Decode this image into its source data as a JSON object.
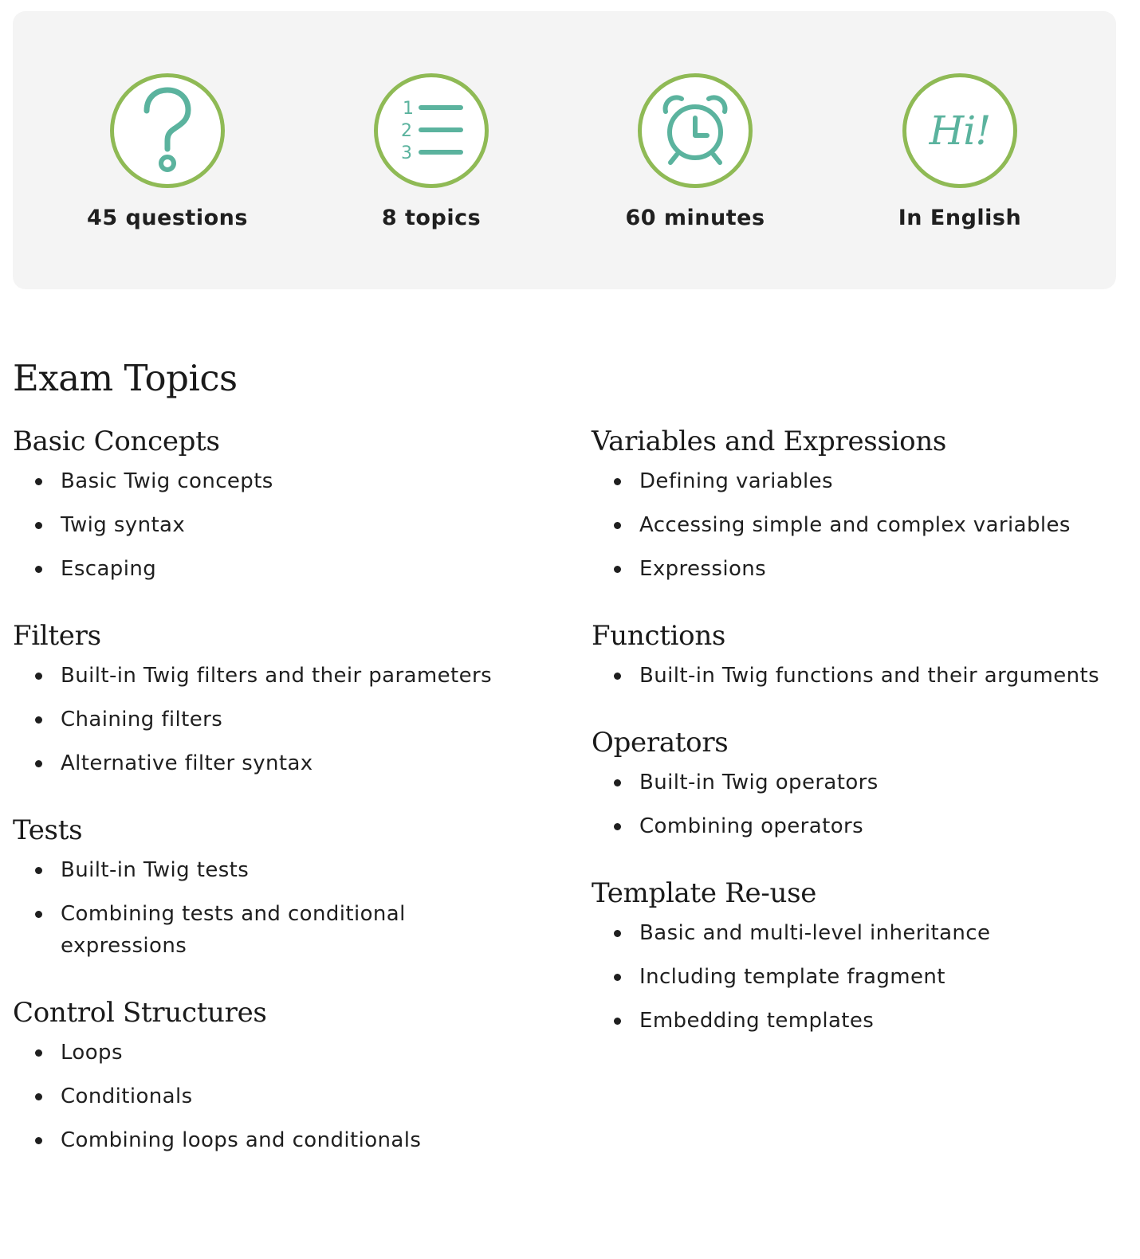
{
  "stats": [
    {
      "name": "questions",
      "icon": "question-mark-icon",
      "label": "45 questions"
    },
    {
      "name": "topics",
      "icon": "numbered-list-icon",
      "label": "8 topics",
      "list_numbers": [
        "1",
        "2",
        "3"
      ]
    },
    {
      "name": "minutes",
      "icon": "alarm-clock-icon",
      "label": "60 minutes"
    },
    {
      "name": "language",
      "icon": "hi-greeting-icon",
      "label": "In English",
      "icon_text": "Hi!"
    }
  ],
  "colors": {
    "accent_ring": "#8fba55",
    "icon_teal": "#5bb39e",
    "panel_bg": "#f4f4f4",
    "text": "#1a1a1a"
  },
  "page_title": "Exam Topics",
  "topics_left": [
    {
      "title": "Basic Concepts",
      "items": [
        "Basic Twig concepts",
        "Twig syntax",
        "Escaping"
      ]
    },
    {
      "title": "Filters",
      "items": [
        "Built-in Twig filters and their parameters",
        "Chaining filters",
        "Alternative filter syntax"
      ]
    },
    {
      "title": "Tests",
      "items": [
        "Built-in Twig tests",
        "Combining tests and conditional expressions"
      ]
    },
    {
      "title": "Control Structures",
      "items": [
        "Loops",
        "Conditionals",
        "Combining loops and conditionals"
      ]
    }
  ],
  "topics_right": [
    {
      "title": "Variables and Expressions",
      "items": [
        "Defining variables",
        "Accessing simple and complex variables",
        "Expressions"
      ]
    },
    {
      "title": "Functions",
      "items": [
        "Built-in Twig functions and their arguments"
      ]
    },
    {
      "title": "Operators",
      "items": [
        "Built-in Twig operators",
        "Combining operators"
      ]
    },
    {
      "title": "Template Re-use",
      "items": [
        "Basic and multi-level inheritance",
        "Including template fragment",
        "Embedding templates"
      ]
    }
  ]
}
